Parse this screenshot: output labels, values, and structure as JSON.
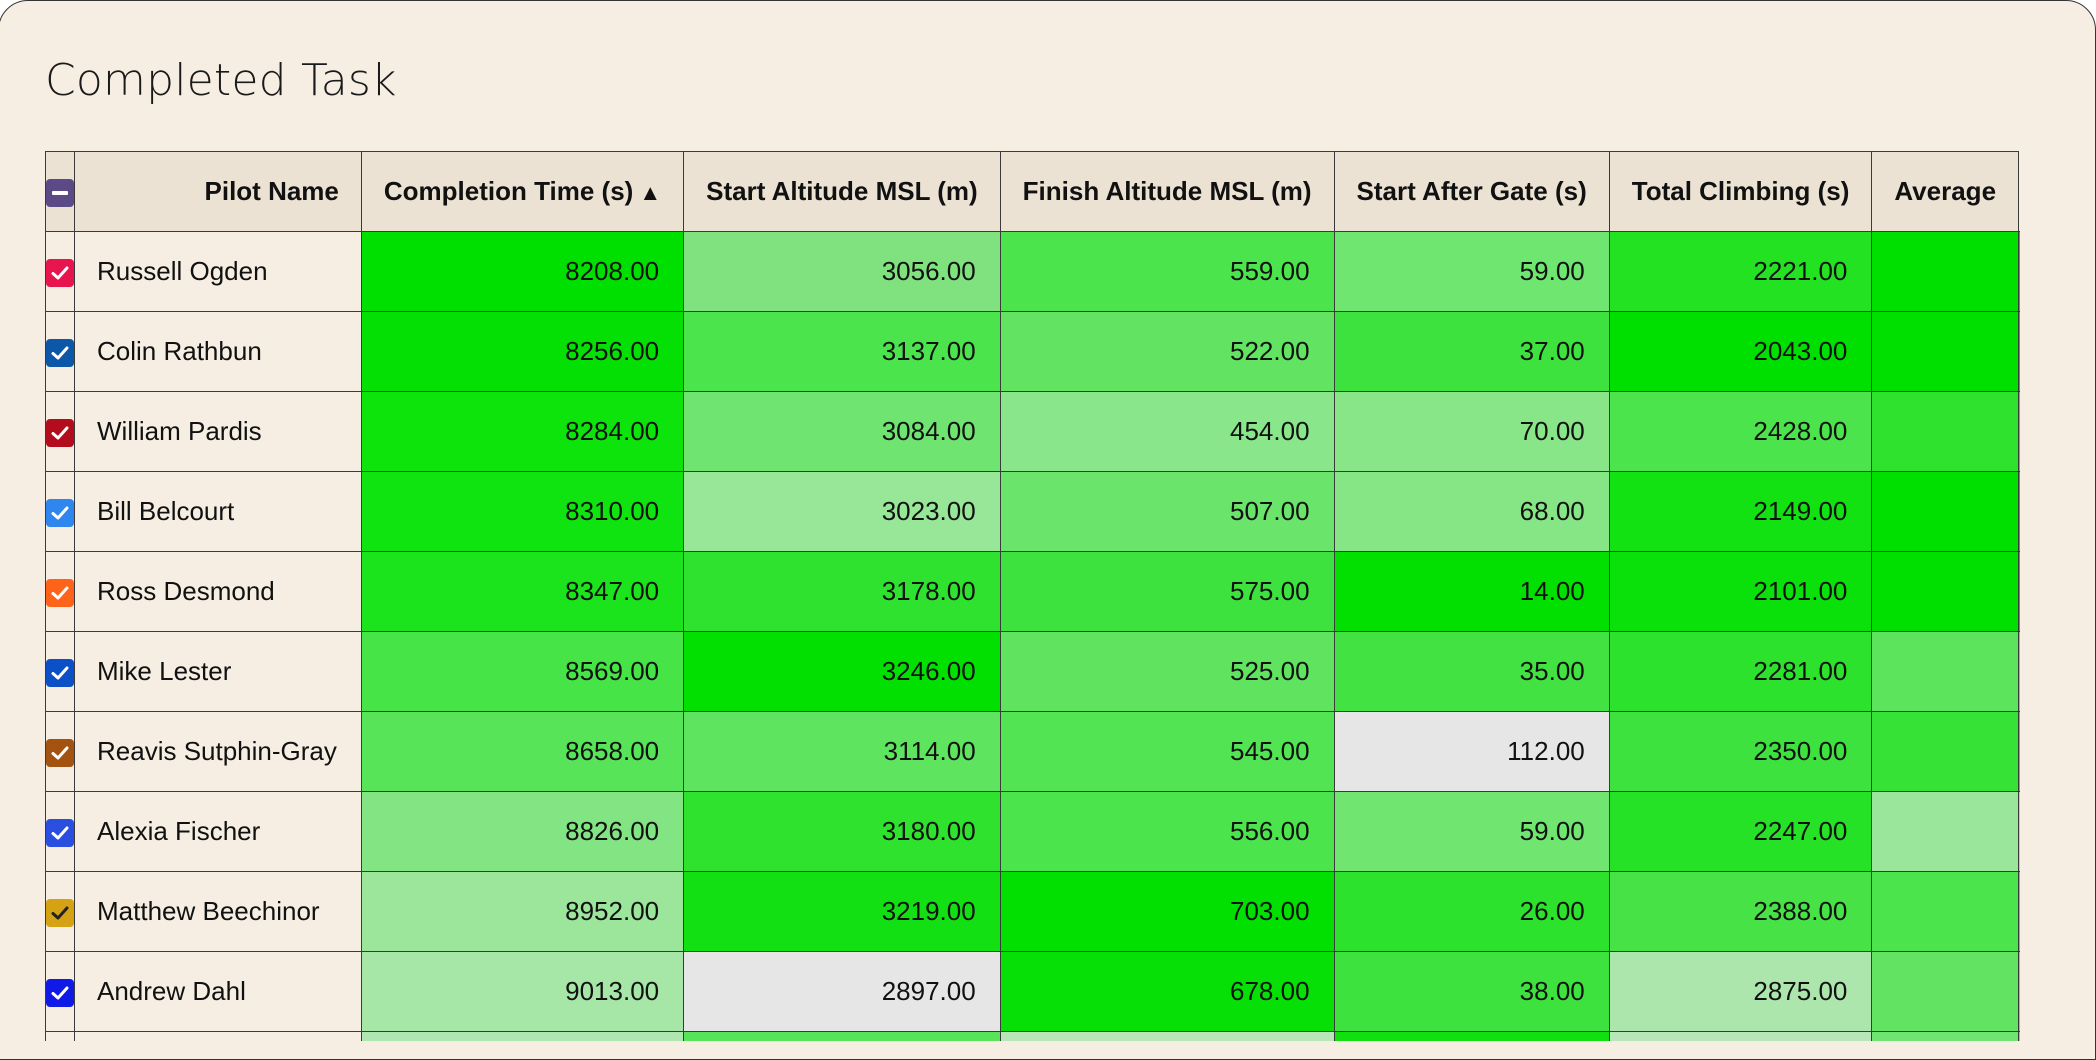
{
  "title": "Completed Task",
  "table": {
    "sort_arrow": "▲",
    "columns": [
      {
        "label": "Pilot Name"
      },
      {
        "label": "Completion Time (s)"
      },
      {
        "label": "Start Altitude MSL (m)"
      },
      {
        "label": "Finish Altitude MSL (m)"
      },
      {
        "label": "Start After Gate (s)"
      },
      {
        "label": "Total Climbing (s)"
      },
      {
        "label": "Average"
      }
    ],
    "rows": [
      {
        "checkbox_color": "#e8144e",
        "name": "Russell Ogden",
        "cells": [
          {
            "v": "8208.00",
            "c": "#00e000"
          },
          {
            "v": "3056.00",
            "c": "#7fe27f"
          },
          {
            "v": "559.00",
            "c": "#4ce44c"
          },
          {
            "v": "59.00",
            "c": "#6fe66f"
          },
          {
            "v": "2221.00",
            "c": "#22e222"
          },
          {
            "v": "",
            "c": "#00e000"
          }
        ]
      },
      {
        "checkbox_color": "#0d57a8",
        "name": "Colin Rathbun",
        "cells": [
          {
            "v": "8256.00",
            "c": "#04e004"
          },
          {
            "v": "3137.00",
            "c": "#4ce44c"
          },
          {
            "v": "522.00",
            "c": "#62e462"
          },
          {
            "v": "37.00",
            "c": "#3ee23e"
          },
          {
            "v": "2043.00",
            "c": "#00e000"
          },
          {
            "v": "",
            "c": "#00e000"
          }
        ]
      },
      {
        "checkbox_color": "#b30d1d",
        "name": "William Pardis",
        "cells": [
          {
            "v": "8284.00",
            "c": "#0ce40c"
          },
          {
            "v": "3084.00",
            "c": "#70e470"
          },
          {
            "v": "454.00",
            "c": "#8ae68a"
          },
          {
            "v": "70.00",
            "c": "#88e688"
          },
          {
            "v": "2428.00",
            "c": "#4ce44c"
          },
          {
            "v": "",
            "c": "#2ee22e"
          }
        ]
      },
      {
        "checkbox_color": "#2f86ef",
        "name": "Bill Belcourt",
        "cells": [
          {
            "v": "8310.00",
            "c": "#10e410"
          },
          {
            "v": "3023.00",
            "c": "#98e698"
          },
          {
            "v": "507.00",
            "c": "#6ae46a"
          },
          {
            "v": "68.00",
            "c": "#86e686"
          },
          {
            "v": "2149.00",
            "c": "#12e212"
          },
          {
            "v": "",
            "c": "#00e000"
          }
        ]
      },
      {
        "checkbox_color": "#ff6319",
        "name": "Ross Desmond",
        "cells": [
          {
            "v": "8347.00",
            "c": "#1ce41c"
          },
          {
            "v": "3178.00",
            "c": "#30e230"
          },
          {
            "v": "575.00",
            "c": "#3ee23e"
          },
          {
            "v": "14.00",
            "c": "#02e002"
          },
          {
            "v": "2101.00",
            "c": "#0ae00a"
          },
          {
            "v": "",
            "c": "#00e000"
          }
        ]
      },
      {
        "checkbox_color": "#0c50c8",
        "name": "Mike Lester",
        "cells": [
          {
            "v": "8569.00",
            "c": "#46e446"
          },
          {
            "v": "3246.00",
            "c": "#02e002"
          },
          {
            "v": "525.00",
            "c": "#60e460"
          },
          {
            "v": "35.00",
            "c": "#42e242"
          },
          {
            "v": "2281.00",
            "c": "#2ce22c"
          },
          {
            "v": "",
            "c": "#5ce45c"
          }
        ]
      },
      {
        "checkbox_color": "#a4520f",
        "name": "Reavis Sutphin-Gray",
        "cells": [
          {
            "v": "8658.00",
            "c": "#58e458"
          },
          {
            "v": "3114.00",
            "c": "#5ee45e"
          },
          {
            "v": "545.00",
            "c": "#52e452"
          },
          {
            "v": "112.00",
            "c": "#e6e6e6"
          },
          {
            "v": "2350.00",
            "c": "#3ee23e"
          },
          {
            "v": "",
            "c": "#36e236"
          }
        ]
      },
      {
        "checkbox_color": "#2a4fe0",
        "name": "Alexia Fischer",
        "cells": [
          {
            "v": "8826.00",
            "c": "#82e482"
          },
          {
            "v": "3180.00",
            "c": "#2ee22e"
          },
          {
            "v": "556.00",
            "c": "#4ce44c"
          },
          {
            "v": "59.00",
            "c": "#70e670"
          },
          {
            "v": "2247.00",
            "c": "#26e226"
          },
          {
            "v": "",
            "c": "#9ae69a"
          }
        ]
      },
      {
        "checkbox_color": "#d4a213",
        "name": "Matthew Beechinor",
        "cells": [
          {
            "v": "8952.00",
            "c": "#9ce69c"
          },
          {
            "v": "3219.00",
            "c": "#12e012"
          },
          {
            "v": "703.00",
            "c": "#02e002"
          },
          {
            "v": "26.00",
            "c": "#2ce22c"
          },
          {
            "v": "2388.00",
            "c": "#46e246"
          },
          {
            "v": "",
            "c": "#4ce44c"
          }
        ]
      },
      {
        "checkbox_color": "#0f1ae6",
        "name": "Andrew Dahl",
        "cells": [
          {
            "v": "9013.00",
            "c": "#a6e6a6"
          },
          {
            "v": "2897.00",
            "c": "#e6e6e6"
          },
          {
            "v": "678.00",
            "c": "#06e006"
          },
          {
            "v": "38.00",
            "c": "#3ee23e"
          },
          {
            "v": "2875.00",
            "c": "#ace6ac"
          },
          {
            "v": "",
            "c": "#62e462"
          }
        ]
      },
      {
        "checkbox_color": "#3a3a3a",
        "name": "",
        "cells": [
          {
            "v": "",
            "c": "#b0e6b0"
          },
          {
            "v": "",
            "c": "#58e458"
          },
          {
            "v": "",
            "c": "#b8e6b8"
          },
          {
            "v": "",
            "c": "#10e010"
          },
          {
            "v": "",
            "c": "#b8e6b8"
          },
          {
            "v": "",
            "c": "#70e470"
          }
        ]
      }
    ]
  }
}
